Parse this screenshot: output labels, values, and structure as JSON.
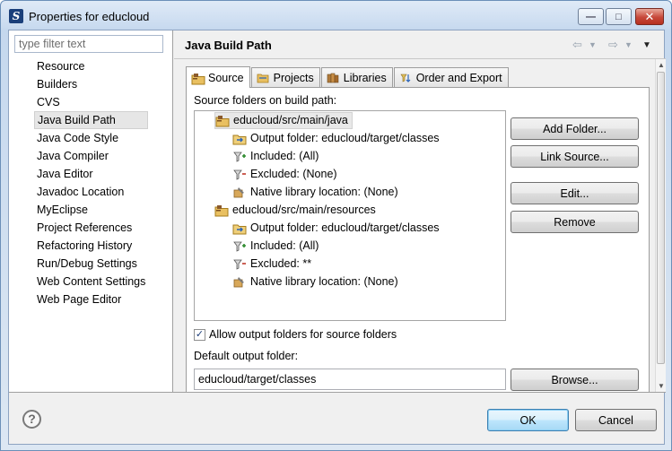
{
  "window": {
    "title": "Properties for educloud",
    "minimize": "—",
    "maximize": "□",
    "close": "✕"
  },
  "filter": {
    "placeholder": "type filter text",
    "value": ""
  },
  "nav": {
    "items": [
      "Resource",
      "Builders",
      "CVS",
      "Java Build Path",
      "Java Code Style",
      "Java Compiler",
      "Java Editor",
      "Javadoc Location",
      "MyEclipse",
      "Project References",
      "Refactoring History",
      "Run/Debug Settings",
      "Web Content Settings",
      "Web Page Editor"
    ],
    "selected": "Java Build Path"
  },
  "page": {
    "title": "Java Build Path",
    "back_glyph": "⇦",
    "forward_glyph": "⇨",
    "menu_glyph": "▼"
  },
  "tabs": [
    {
      "label": "Source",
      "icon": "source-folder-icon",
      "active": true
    },
    {
      "label": "Projects",
      "icon": "projects-icon",
      "active": false
    },
    {
      "label": "Libraries",
      "icon": "libraries-icon",
      "active": false
    },
    {
      "label": "Order and Export",
      "icon": "order-export-icon",
      "active": false
    }
  ],
  "source_tab": {
    "folders_label": "Source folders on build path:",
    "tree": [
      {
        "label": "educloud/src/main/java",
        "icon": "source-folder-icon",
        "level": 0
      },
      {
        "label": "Output folder: educloud/target/classes",
        "icon": "output-folder-icon",
        "level": 1
      },
      {
        "label": "Included: (All)",
        "icon": "inclusion-filter-icon",
        "level": 1
      },
      {
        "label": "Excluded: (None)",
        "icon": "exclusion-filter-icon",
        "level": 1
      },
      {
        "label": "Native library location: (None)",
        "icon": "native-library-icon",
        "level": 1
      },
      {
        "label": "educloud/src/main/resources",
        "icon": "source-folder-icon",
        "level": 0
      },
      {
        "label": "Output folder: educloud/target/classes",
        "icon": "output-folder-icon",
        "level": 1
      },
      {
        "label": "Included: (All)",
        "icon": "inclusion-filter-icon",
        "level": 1
      },
      {
        "label": "Excluded: **",
        "icon": "exclusion-filter-icon",
        "level": 1
      },
      {
        "label": "Native library location: (None)",
        "icon": "native-library-icon",
        "level": 1
      }
    ],
    "buttons": {
      "add_folder": "Add Folder...",
      "link_source": "Link Source...",
      "edit": "Edit...",
      "remove": "Remove",
      "browse": "Browse..."
    },
    "allow_output_label": "Allow output folders for source folders",
    "allow_output_checked": true,
    "check_glyph": "✓",
    "default_output_label": "Default output folder:",
    "default_output_value": "educloud/target/classes"
  },
  "footer": {
    "help_glyph": "?",
    "ok": "OK",
    "cancel": "Cancel"
  },
  "colors": {
    "accent": "#3c7fb1",
    "folder": "#e5b74a",
    "tree_selection": "#e8e8e8"
  }
}
